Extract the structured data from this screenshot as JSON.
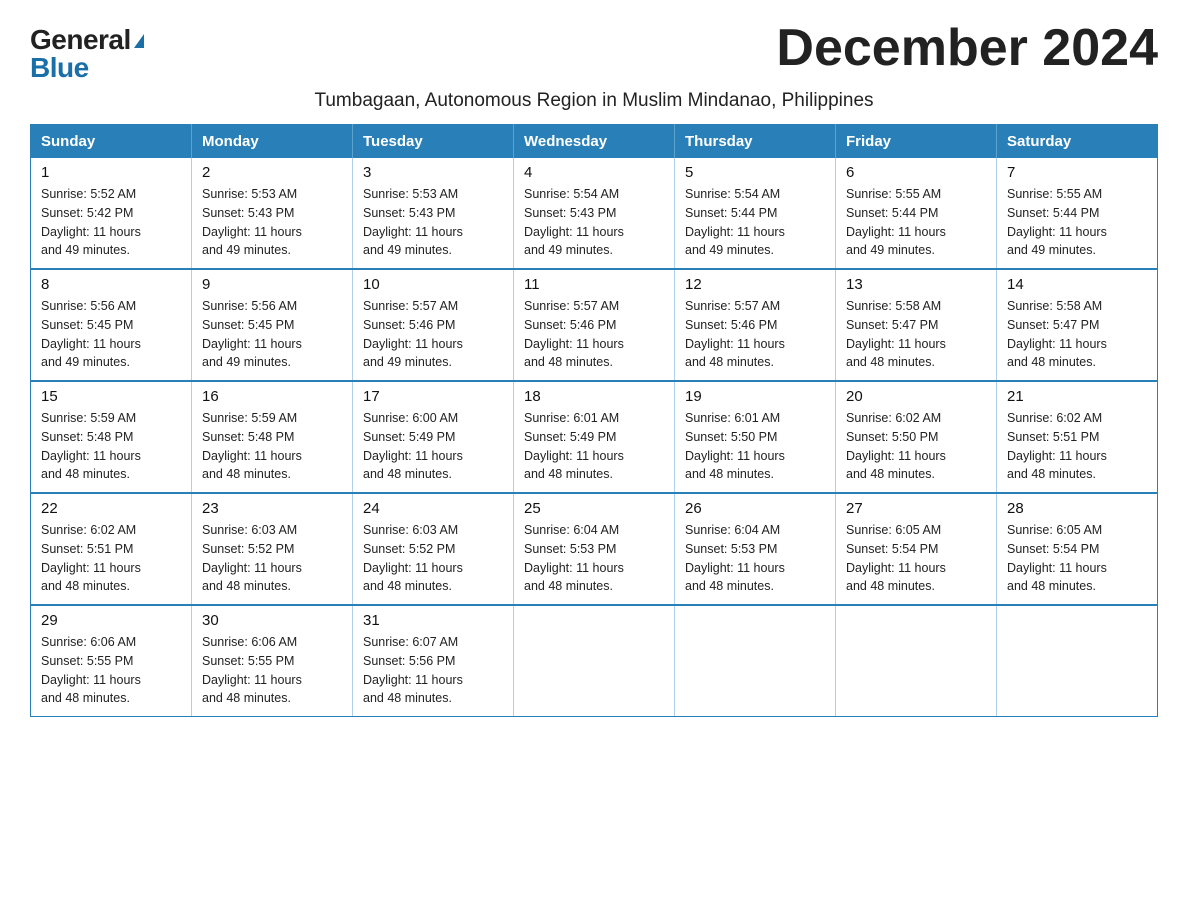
{
  "logo": {
    "general": "General",
    "blue": "Blue"
  },
  "title": "December 2024",
  "location": "Tumbagaan, Autonomous Region in Muslim Mindanao, Philippines",
  "days_of_week": [
    "Sunday",
    "Monday",
    "Tuesday",
    "Wednesday",
    "Thursday",
    "Friday",
    "Saturday"
  ],
  "weeks": [
    [
      {
        "day": "1",
        "sunrise": "5:52 AM",
        "sunset": "5:42 PM",
        "daylight": "11 hours and 49 minutes."
      },
      {
        "day": "2",
        "sunrise": "5:53 AM",
        "sunset": "5:43 PM",
        "daylight": "11 hours and 49 minutes."
      },
      {
        "day": "3",
        "sunrise": "5:53 AM",
        "sunset": "5:43 PM",
        "daylight": "11 hours and 49 minutes."
      },
      {
        "day": "4",
        "sunrise": "5:54 AM",
        "sunset": "5:43 PM",
        "daylight": "11 hours and 49 minutes."
      },
      {
        "day": "5",
        "sunrise": "5:54 AM",
        "sunset": "5:44 PM",
        "daylight": "11 hours and 49 minutes."
      },
      {
        "day": "6",
        "sunrise": "5:55 AM",
        "sunset": "5:44 PM",
        "daylight": "11 hours and 49 minutes."
      },
      {
        "day": "7",
        "sunrise": "5:55 AM",
        "sunset": "5:44 PM",
        "daylight": "11 hours and 49 minutes."
      }
    ],
    [
      {
        "day": "8",
        "sunrise": "5:56 AM",
        "sunset": "5:45 PM",
        "daylight": "11 hours and 49 minutes."
      },
      {
        "day": "9",
        "sunrise": "5:56 AM",
        "sunset": "5:45 PM",
        "daylight": "11 hours and 49 minutes."
      },
      {
        "day": "10",
        "sunrise": "5:57 AM",
        "sunset": "5:46 PM",
        "daylight": "11 hours and 49 minutes."
      },
      {
        "day": "11",
        "sunrise": "5:57 AM",
        "sunset": "5:46 PM",
        "daylight": "11 hours and 48 minutes."
      },
      {
        "day": "12",
        "sunrise": "5:57 AM",
        "sunset": "5:46 PM",
        "daylight": "11 hours and 48 minutes."
      },
      {
        "day": "13",
        "sunrise": "5:58 AM",
        "sunset": "5:47 PM",
        "daylight": "11 hours and 48 minutes."
      },
      {
        "day": "14",
        "sunrise": "5:58 AM",
        "sunset": "5:47 PM",
        "daylight": "11 hours and 48 minutes."
      }
    ],
    [
      {
        "day": "15",
        "sunrise": "5:59 AM",
        "sunset": "5:48 PM",
        "daylight": "11 hours and 48 minutes."
      },
      {
        "day": "16",
        "sunrise": "5:59 AM",
        "sunset": "5:48 PM",
        "daylight": "11 hours and 48 minutes."
      },
      {
        "day": "17",
        "sunrise": "6:00 AM",
        "sunset": "5:49 PM",
        "daylight": "11 hours and 48 minutes."
      },
      {
        "day": "18",
        "sunrise": "6:01 AM",
        "sunset": "5:49 PM",
        "daylight": "11 hours and 48 minutes."
      },
      {
        "day": "19",
        "sunrise": "6:01 AM",
        "sunset": "5:50 PM",
        "daylight": "11 hours and 48 minutes."
      },
      {
        "day": "20",
        "sunrise": "6:02 AM",
        "sunset": "5:50 PM",
        "daylight": "11 hours and 48 minutes."
      },
      {
        "day": "21",
        "sunrise": "6:02 AM",
        "sunset": "5:51 PM",
        "daylight": "11 hours and 48 minutes."
      }
    ],
    [
      {
        "day": "22",
        "sunrise": "6:02 AM",
        "sunset": "5:51 PM",
        "daylight": "11 hours and 48 minutes."
      },
      {
        "day": "23",
        "sunrise": "6:03 AM",
        "sunset": "5:52 PM",
        "daylight": "11 hours and 48 minutes."
      },
      {
        "day": "24",
        "sunrise": "6:03 AM",
        "sunset": "5:52 PM",
        "daylight": "11 hours and 48 minutes."
      },
      {
        "day": "25",
        "sunrise": "6:04 AM",
        "sunset": "5:53 PM",
        "daylight": "11 hours and 48 minutes."
      },
      {
        "day": "26",
        "sunrise": "6:04 AM",
        "sunset": "5:53 PM",
        "daylight": "11 hours and 48 minutes."
      },
      {
        "day": "27",
        "sunrise": "6:05 AM",
        "sunset": "5:54 PM",
        "daylight": "11 hours and 48 minutes."
      },
      {
        "day": "28",
        "sunrise": "6:05 AM",
        "sunset": "5:54 PM",
        "daylight": "11 hours and 48 minutes."
      }
    ],
    [
      {
        "day": "29",
        "sunrise": "6:06 AM",
        "sunset": "5:55 PM",
        "daylight": "11 hours and 48 minutes."
      },
      {
        "day": "30",
        "sunrise": "6:06 AM",
        "sunset": "5:55 PM",
        "daylight": "11 hours and 48 minutes."
      },
      {
        "day": "31",
        "sunrise": "6:07 AM",
        "sunset": "5:56 PM",
        "daylight": "11 hours and 48 minutes."
      },
      null,
      null,
      null,
      null
    ]
  ],
  "labels": {
    "sunrise": "Sunrise:",
    "sunset": "Sunset:",
    "daylight": "Daylight:"
  }
}
